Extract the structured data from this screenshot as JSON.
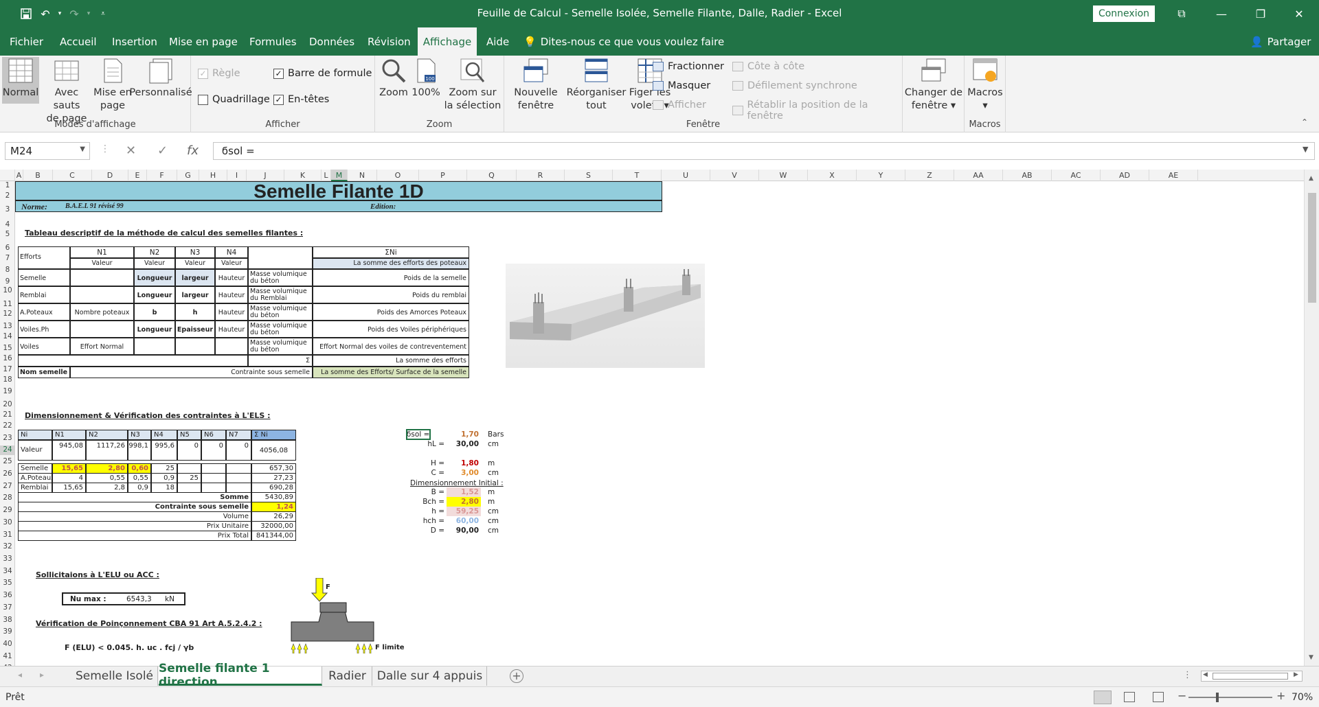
{
  "window": {
    "title": "Feuille de Calcul - Semelle Isolée, Semelle Filante, Dalle, Radier  -  Excel",
    "login": "Connexion"
  },
  "ribbon_tabs": [
    "Fichier",
    "Accueil",
    "Insertion",
    "Mise en page",
    "Formules",
    "Données",
    "Révision",
    "Affichage",
    "Aide"
  ],
  "tellme": "Dites-nous ce que vous voulez faire",
  "share": "Partager",
  "ribbon": {
    "modes": {
      "normal": "Normal",
      "sauts1": "Avec sauts",
      "sauts2": "de page",
      "mep1": "Mise en",
      "mep2": "page",
      "perso": "Personnalisé",
      "label": "Modes d'affichage"
    },
    "afficher": {
      "regle": "Règle",
      "quadrillage": "Quadrillage",
      "barre": "Barre de formule",
      "entetes": "En-têtes",
      "label": "Afficher"
    },
    "zoom": {
      "zoom": "Zoom",
      "cent": "100%",
      "sel1": "Zoom sur",
      "sel2": "la sélection",
      "label": "Zoom"
    },
    "fenetre": {
      "nouvelle1": "Nouvelle",
      "nouvelle2": "fenêtre",
      "reorg1": "Réorganiser",
      "reorg2": "tout",
      "figer1": "Figer les",
      "figer2": "volets",
      "fractionner": "Fractionner",
      "masquer": "Masquer",
      "afficher": "Afficher",
      "cote": "Côte à côte",
      "defilement": "Défilement synchrone",
      "retablir": "Rétablir la position de la fenêtre",
      "changer1": "Changer de",
      "changer2": "fenêtre",
      "label": "Fenêtre"
    },
    "macros": {
      "macros": "Macros",
      "label": "Macros"
    }
  },
  "formula_bar": {
    "name_box": "M24",
    "formula": "ϭsol ="
  },
  "columns": [
    "A",
    "B",
    "C",
    "D",
    "E",
    "F",
    "G",
    "H",
    "I",
    "J",
    "K",
    "L",
    "M",
    "N",
    "O",
    "P",
    "Q",
    "R",
    "S",
    "T",
    "U",
    "V",
    "W",
    "X",
    "Y",
    "Z",
    "AA",
    "AB",
    "AC",
    "AD",
    "AE"
  ],
  "rows": [
    "1",
    "2",
    "3",
    "4",
    "5",
    "6",
    "7",
    "8",
    "9",
    "10",
    "11",
    "12",
    "13",
    "14",
    "15",
    "16",
    "17",
    "18",
    "19",
    "20",
    "21",
    "22",
    "23",
    "24",
    "25",
    "26",
    "27",
    "28",
    "29",
    "30",
    "31",
    "32",
    "33",
    "34",
    "35",
    "36",
    "37",
    "38",
    "39",
    "40",
    "41",
    "42"
  ],
  "sheet": {
    "title": "Semelle Filante 1D",
    "norme_label": "Norme:",
    "norme_value": "B.A.E.L 91 révisé 99",
    "edition": "Edition:",
    "section1": "Tableau descriptif de la méthode de calcul des semelles filantes :",
    "t1": {
      "efforts": "Efforts",
      "n1": "N1",
      "n2": "N2",
      "n3": "N3",
      "n4": "N4",
      "sumNi": "ΣNi",
      "valeur": "Valeur",
      "somme_poteaux": "La somme des  efforts des poteaux",
      "semelle": "Semelle",
      "remblai": "Remblai",
      "apoteaux": "A.Poteaux",
      "voilesph": "Voiles.Ph",
      "voiles": "Voiles",
      "longueur": "Longueur",
      "largeur": "largeur",
      "hauteur": "Hauteur",
      "b": "b",
      "h": "h",
      "epaisseur": "Epaisseur",
      "nb_poteaux": "Nombre poteaux",
      "effort_normal": "Effort Normal",
      "mv_beton": "Masse volumique du béton",
      "mv_remblai": "Masse volumique du Remblai",
      "poids_semelle": "Poids de la semelle",
      "poids_remblai": "Poids du remblai",
      "poids_amorces": "Poids des Amorces Poteaux",
      "poids_voiles": "Poids des Voiles périphériques",
      "effort_voiles": "Effort Normal des voiles de contreventement",
      "sigma": "Σ",
      "somme_efforts": "La somme des efforts",
      "nom_semelle": "Nom semelle",
      "contrainte": "Contrainte sous semelle",
      "formule": "La somme des Efforts/ Surface de la semelle"
    },
    "section2": "Dimensionnement & Vérification des contraintes à L'ELS :",
    "t2": {
      "headers": [
        "Ni",
        "N1",
        "N2",
        "N3",
        "N4",
        "N5",
        "N6",
        "N7",
        "Σ Ni"
      ],
      "valeur_row": [
        "Valeur",
        "945,08",
        "1117,26",
        "998,1",
        "995,6",
        "0",
        "",
        "0",
        "0",
        "4056,08"
      ],
      "semelle_row": [
        "Semelle",
        "15,65",
        "2,80",
        "0,60",
        "25",
        "",
        "",
        "",
        "657,30"
      ],
      "apoteaux_row": [
        "A.Poteaux",
        "4",
        "0,55",
        "0,55",
        "0,9",
        "25",
        "",
        "",
        "27,23"
      ],
      "remblai_row": [
        "Remblai",
        "15,65",
        "2,8",
        "0,9",
        "18",
        "",
        "",
        "",
        "690,28"
      ],
      "somme": "Somme",
      "somme_v": "5430,89",
      "contrainte": "Contrainte sous semelle",
      "contrainte_v": "1,24",
      "volume": "Volume",
      "volume_v": "26,29",
      "prix_u": "Prix Unitaire",
      "prix_u_v": "32000,00",
      "prix_t": "Prix Total",
      "prix_t_v": "841344,00"
    },
    "side": {
      "sol_l": "ϭsol =",
      "sol_v": "1,70",
      "sol_u": "Bars",
      "hl_l": "hL =",
      "hl_v": "30,00",
      "hl_u": "cm",
      "H_l": "H =",
      "H_v": "1,80",
      "H_u": "m",
      "C_l": "C =",
      "C_v": "3,00",
      "C_u": "cm",
      "dim_init": "Dimensionnement Initial :",
      "B_l": "B =",
      "B_v": "1,52",
      "B_u": "m",
      "Bch_l": "Bch =",
      "Bch_v": "2,80",
      "Bch_u": "m",
      "h_l": "h =",
      "h_v": "59,25",
      "h_u": "cm",
      "hch_l": "hch =",
      "hch_v": "60,00",
      "hch_u": "cm",
      "D_l": "D =",
      "D_v": "90,00",
      "D_u": "cm"
    },
    "section3": "Sollicitaions à L'ELU ou ACC :",
    "nu_max_label": "Nu max :",
    "nu_max_value": "6543,3",
    "nu_max_unit": "kN",
    "section4": "Vérification de Poinçonnement CBA 91 Art A.5.2.4.2 :",
    "formula_poinc": "F (ELU) < 0.045. h. uc . fcj / γb",
    "fig_F": "F",
    "fig_Flimite": "F limite"
  },
  "sheet_tabs": [
    "Semelle Isolé",
    "Semelle filante 1 direction",
    "Radier",
    "Dalle sur 4 appuis"
  ],
  "status": {
    "ready": "Prêt",
    "zoom": "70%"
  },
  "colors": {
    "excel_green": "#217346",
    "title_band": "#92cddc",
    "yellow": "#ffff00",
    "light_blue": "#dce6f1",
    "light_green": "#d8e4bc"
  }
}
